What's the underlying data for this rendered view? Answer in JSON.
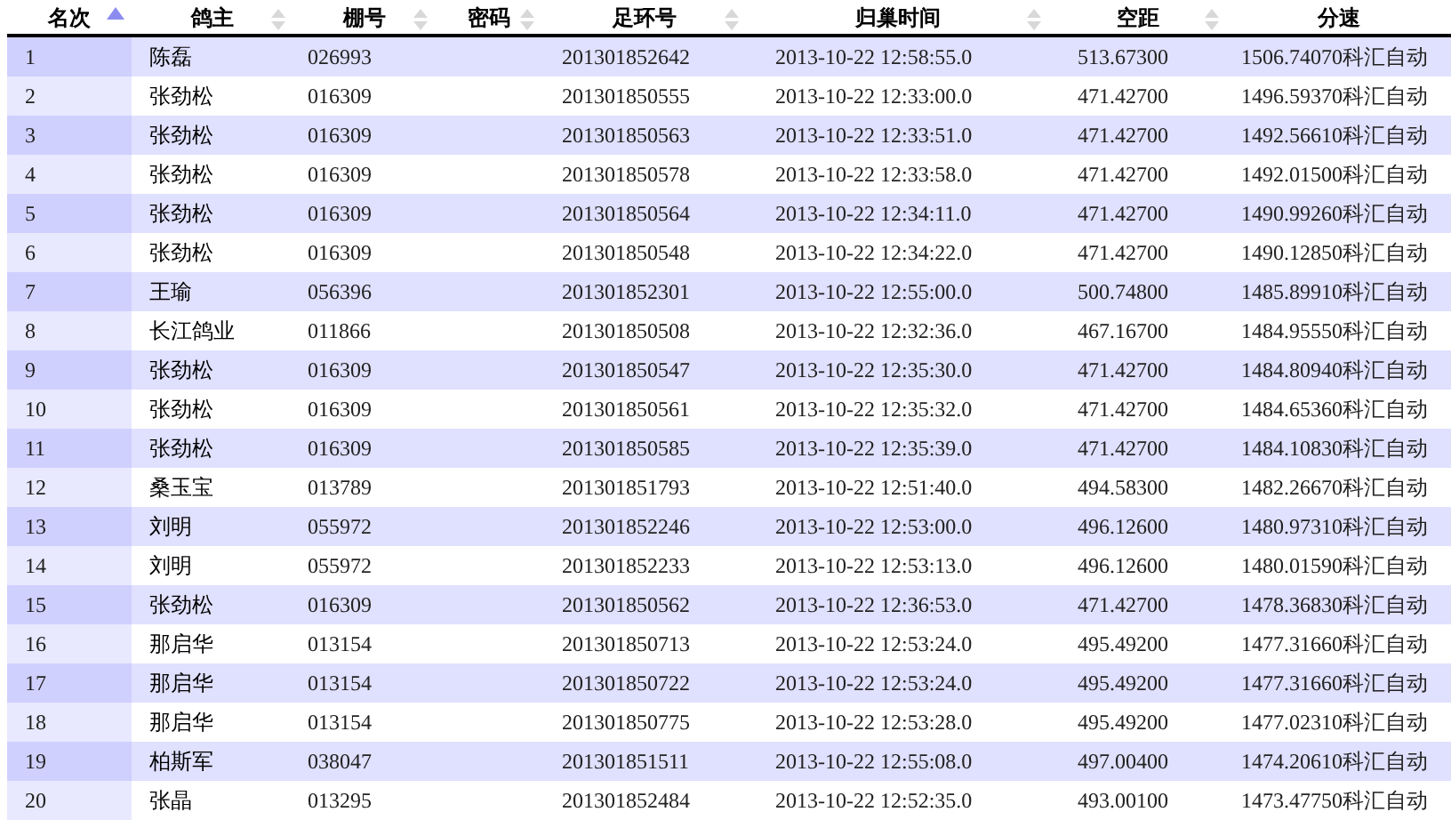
{
  "table": {
    "columns": [
      {
        "label": "名次",
        "sorted": true
      },
      {
        "label": "鸽主",
        "sorted": false
      },
      {
        "label": "棚号",
        "sorted": false
      },
      {
        "label": "密码",
        "sorted": false
      },
      {
        "label": "足环号",
        "sorted": false
      },
      {
        "label": "归巢时间",
        "sorted": false
      },
      {
        "label": "空距",
        "sorted": false
      },
      {
        "label": "分速"
      }
    ],
    "rows": [
      [
        "1",
        "陈磊",
        "026993",
        "",
        "201301852642",
        "2013-10-22 12:58:55.0",
        "513.67300",
        "1506.74070科汇自动"
      ],
      [
        "2",
        "张劲松",
        "016309",
        "",
        "201301850555",
        "2013-10-22 12:33:00.0",
        "471.42700",
        "1496.59370科汇自动"
      ],
      [
        "3",
        "张劲松",
        "016309",
        "",
        "201301850563",
        "2013-10-22 12:33:51.0",
        "471.42700",
        "1492.56610科汇自动"
      ],
      [
        "4",
        "张劲松",
        "016309",
        "",
        "201301850578",
        "2013-10-22 12:33:58.0",
        "471.42700",
        "1492.01500科汇自动"
      ],
      [
        "5",
        "张劲松",
        "016309",
        "",
        "201301850564",
        "2013-10-22 12:34:11.0",
        "471.42700",
        "1490.99260科汇自动"
      ],
      [
        "6",
        "张劲松",
        "016309",
        "",
        "201301850548",
        "2013-10-22 12:34:22.0",
        "471.42700",
        "1490.12850科汇自动"
      ],
      [
        "7",
        "王瑜",
        "056396",
        "",
        "201301852301",
        "2013-10-22 12:55:00.0",
        "500.74800",
        "1485.89910科汇自动"
      ],
      [
        "8",
        "长江鸽业",
        "011866",
        "",
        "201301850508",
        "2013-10-22 12:32:36.0",
        "467.16700",
        "1484.95550科汇自动"
      ],
      [
        "9",
        "张劲松",
        "016309",
        "",
        "201301850547",
        "2013-10-22 12:35:30.0",
        "471.42700",
        "1484.80940科汇自动"
      ],
      [
        "10",
        "张劲松",
        "016309",
        "",
        "201301850561",
        "2013-10-22 12:35:32.0",
        "471.42700",
        "1484.65360科汇自动"
      ],
      [
        "11",
        "张劲松",
        "016309",
        "",
        "201301850585",
        "2013-10-22 12:35:39.0",
        "471.42700",
        "1484.10830科汇自动"
      ],
      [
        "12",
        "桑玉宝",
        "013789",
        "",
        "201301851793",
        "2013-10-22 12:51:40.0",
        "494.58300",
        "1482.26670科汇自动"
      ],
      [
        "13",
        "刘明",
        "055972",
        "",
        "201301852246",
        "2013-10-22 12:53:00.0",
        "496.12600",
        "1480.97310科汇自动"
      ],
      [
        "14",
        "刘明",
        "055972",
        "",
        "201301852233",
        "2013-10-22 12:53:13.0",
        "496.12600",
        "1480.01590科汇自动"
      ],
      [
        "15",
        "张劲松",
        "016309",
        "",
        "201301850562",
        "2013-10-22 12:36:53.0",
        "471.42700",
        "1478.36830科汇自动"
      ],
      [
        "16",
        "那启华",
        "013154",
        "",
        "201301850713",
        "2013-10-22 12:53:24.0",
        "495.49200",
        "1477.31660科汇自动"
      ],
      [
        "17",
        "那启华",
        "013154",
        "",
        "201301850722",
        "2013-10-22 12:53:24.0",
        "495.49200",
        "1477.31660科汇自动"
      ],
      [
        "18",
        "那启华",
        "013154",
        "",
        "201301850775",
        "2013-10-22 12:53:28.0",
        "495.49200",
        "1477.02310科汇自动"
      ],
      [
        "19",
        "柏斯军",
        "038047",
        "",
        "201301851511",
        "2013-10-22 12:55:08.0",
        "497.00400",
        "1474.20610科汇自动"
      ],
      [
        "20",
        "张晶",
        "013295",
        "",
        "201301852484",
        "2013-10-22 12:52:35.0",
        "493.00100",
        "1473.47750科汇自动"
      ]
    ]
  }
}
